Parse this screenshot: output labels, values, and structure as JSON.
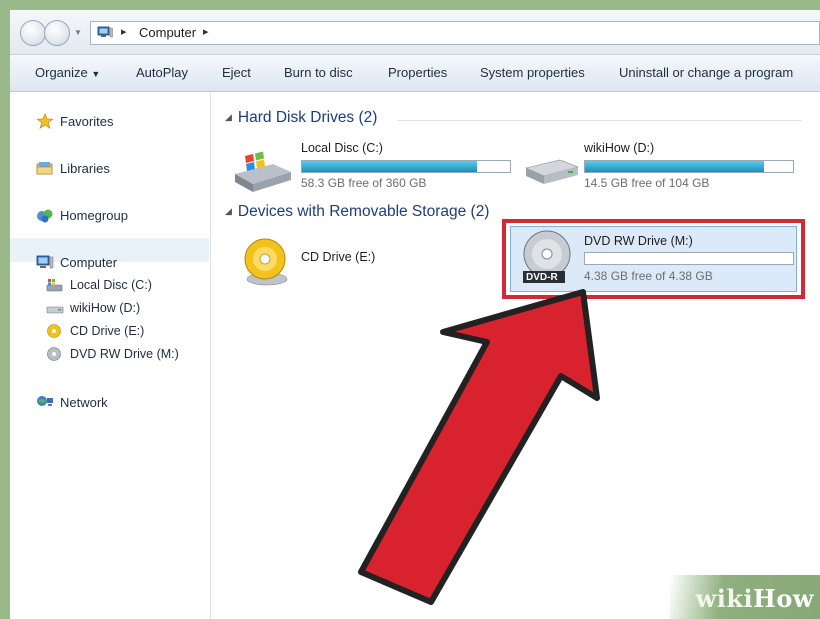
{
  "address": {
    "path": "Computer"
  },
  "toolbar": {
    "organize": "Organize",
    "autoplay": "AutoPlay",
    "eject": "Eject",
    "burn": "Burn to disc",
    "properties": "Properties",
    "system_properties": "System properties",
    "uninstall": "Uninstall or change a program"
  },
  "sidebar": {
    "favorites": "Favorites",
    "libraries": "Libraries",
    "homegroup": "Homegroup",
    "computer": "Computer",
    "local_disc": "Local Disc (C:)",
    "wikihow": "wikiHow (D:)",
    "cd_drive": "CD Drive (E:)",
    "dvd_drive": "DVD RW Drive (M:)",
    "network": "Network"
  },
  "groups": {
    "hard_disks": {
      "title": "Hard Disk Drives (2)",
      "drives": [
        {
          "name": "Local Disc (C:)",
          "free": "58.3 GB free of 360 GB",
          "used_fraction": 0.84
        },
        {
          "name": "wikiHow (D:)",
          "free": "14.5 GB free of 104 GB",
          "used_fraction": 0.86
        }
      ]
    },
    "removable": {
      "title": "Devices with Removable Storage (2)",
      "drives": [
        {
          "name": "CD Drive (E:)"
        },
        {
          "name": "DVD RW Drive (M:)",
          "free": "4.38 GB free of 4.38 GB",
          "used_fraction": 0.0,
          "disc_label": "DVD-R"
        }
      ]
    }
  },
  "watermark": {
    "wiki": "wiki",
    "how": "How"
  },
  "colors": {
    "highlight_box": "#cf2a35",
    "arrow": "#d8232f",
    "bar_fill": "#1d8fb8"
  }
}
